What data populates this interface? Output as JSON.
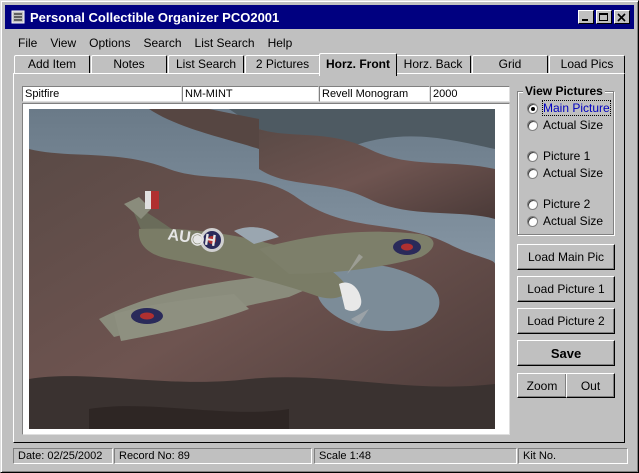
{
  "window": {
    "title": "Personal Collectible Organizer PCO2001"
  },
  "menu": [
    "File",
    "View",
    "Options",
    "Search",
    "List Search",
    "Help"
  ],
  "tabs": [
    "Add Item",
    "Notes",
    "List Search",
    "2 Pictures",
    "Horz. Front",
    "Horz. Back",
    "Grid",
    "Load Pics"
  ],
  "active_tab": "Horz. Front",
  "record": {
    "name": "Spitfire",
    "condition": "NM-MINT",
    "maker": "Revell Monogram",
    "year": "2000"
  },
  "view_pictures": {
    "title": "View Pictures",
    "options": [
      {
        "label": "Main Picture",
        "checked": true
      },
      {
        "label": "Actual Size",
        "checked": false
      },
      {
        "label": "Picture 1",
        "checked": false
      },
      {
        "label": "Actual Size",
        "checked": false
      },
      {
        "label": "Picture 2",
        "checked": false
      },
      {
        "label": "Actual Size",
        "checked": false
      }
    ]
  },
  "buttons": {
    "load_main_pic": "Load Main Pic",
    "load_picture_1": "Load Picture 1",
    "load_picture_2": "Load Picture 2",
    "save": "Save",
    "zoom": "Zoom",
    "out": "Out"
  },
  "picture": {
    "aircraft_markings": "AU◉H"
  },
  "status": {
    "date": "Date: 02/25/2002",
    "record_no": "Record No: 89",
    "scale": "Scale 1:48",
    "kit_no": "Kit No."
  },
  "colors": {
    "title_bar": "#000080",
    "face": "#c0c0c0",
    "focus_text": "#0000c0"
  }
}
